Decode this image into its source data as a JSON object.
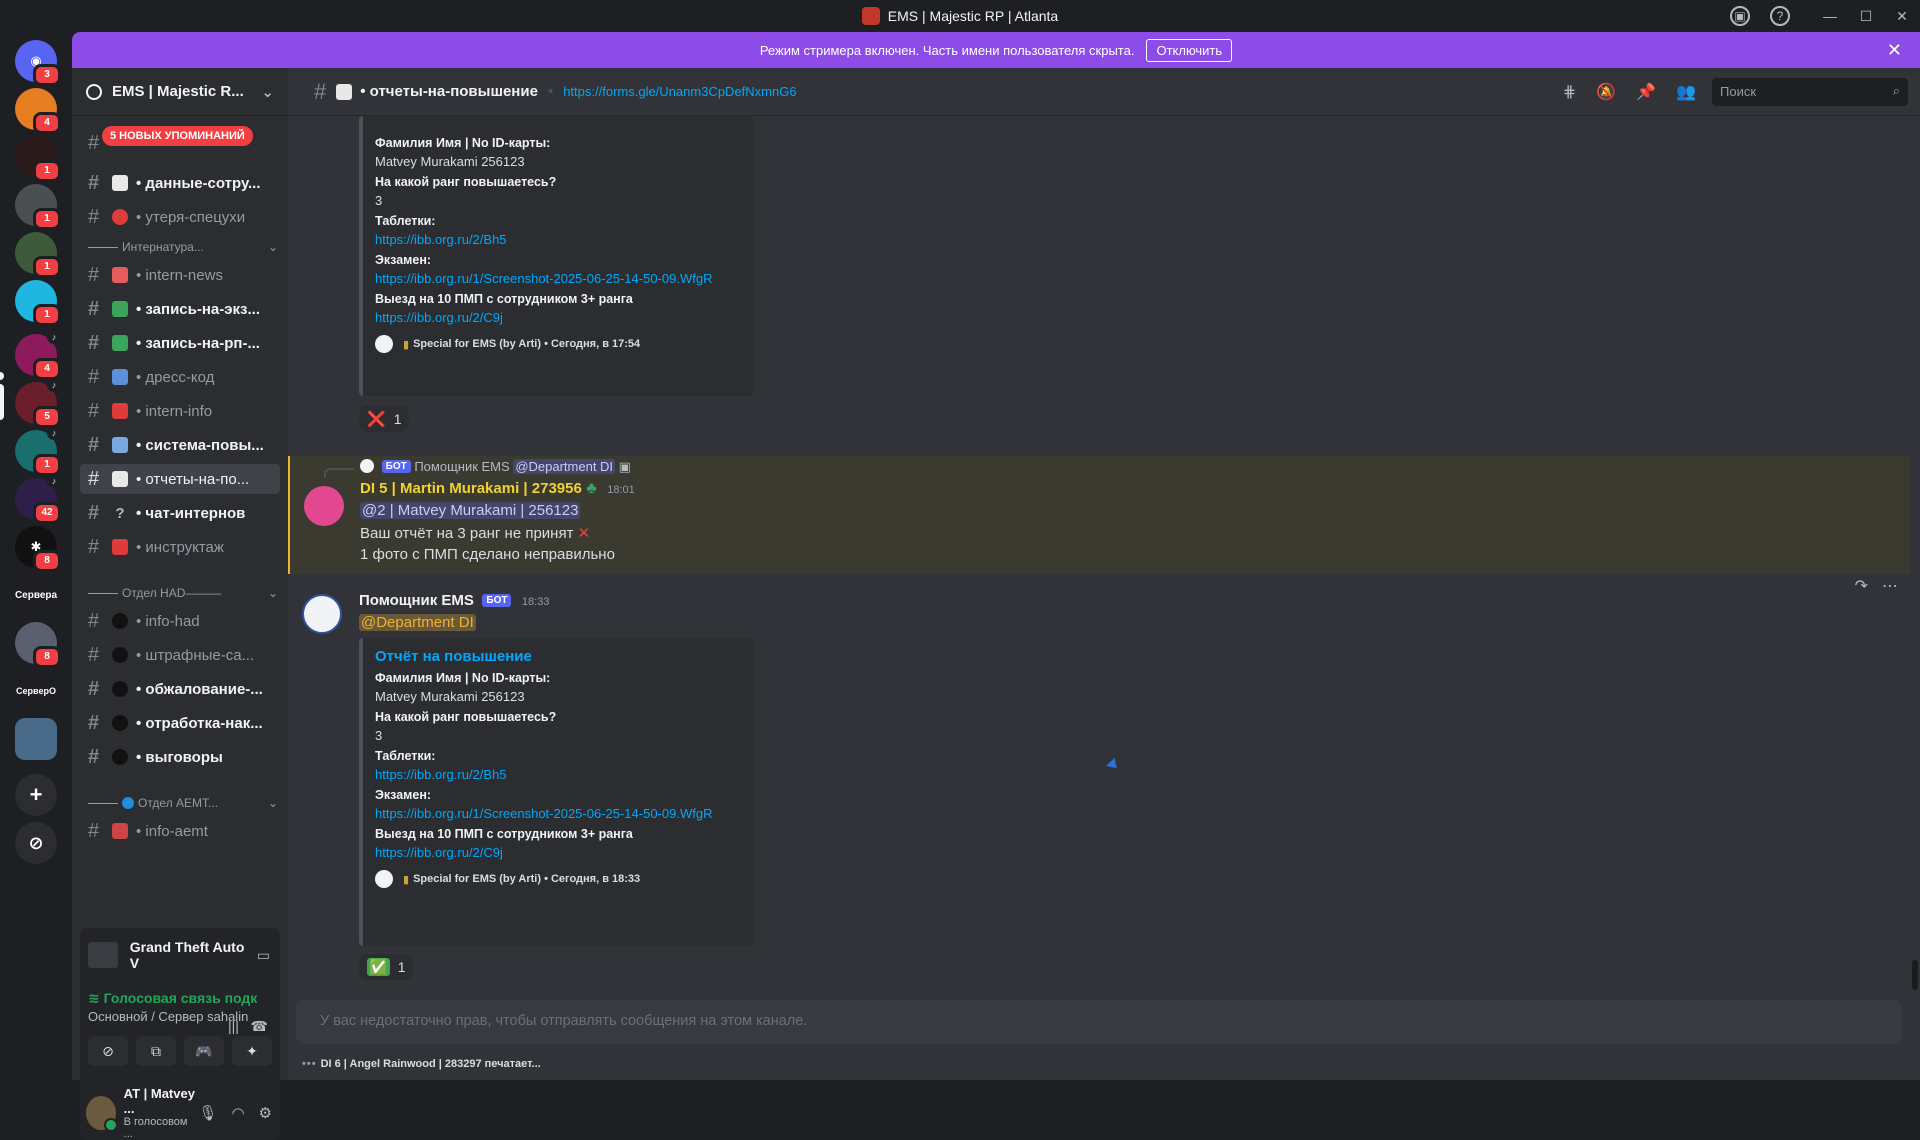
{
  "window": {
    "title": "EMS | Majestic RP | Atlanta"
  },
  "streamer_banner": {
    "text": "Режим стримера включен. Часть имени пользователя скрыта.",
    "button": "Отключить"
  },
  "guilds": [
    {
      "badge": "3"
    },
    {
      "badge": "4"
    },
    {
      "badge": "1"
    },
    {
      "badge": "1"
    },
    {
      "badge": "1"
    },
    {
      "badge": "1"
    },
    {
      "badge": "4"
    },
    {
      "badge": "5"
    },
    {
      "badge": "1"
    },
    {
      "badge": "42"
    },
    {
      "badge": "8"
    },
    {
      "label": "Сервера"
    },
    {
      "badge": "8"
    },
    {
      "label": "СерверО"
    },
    {
      "badge": ""
    }
  ],
  "server": {
    "name": "EMS | Majestic R...",
    "mentions_pill": "5 НОВЫХ УПОМИНАНИЙ",
    "channels_top": [
      {
        "name": "• данные-сотру...",
        "unread": true
      },
      {
        "name": "• утеря-спецухи",
        "unread": false
      }
    ],
    "category_intern": "Интернатура...",
    "channels_intern": [
      {
        "name": "• intern-news",
        "unread": false
      },
      {
        "name": "• запись-на-экз...",
        "unread": true
      },
      {
        "name": "• запись-на-рп-...",
        "unread": true
      },
      {
        "name": "• дресс-код",
        "unread": false
      },
      {
        "name": "• intern-info",
        "unread": false
      },
      {
        "name": "• система-повы...",
        "unread": true
      },
      {
        "name": "• отчеты-на-по...",
        "unread": false,
        "active": true
      },
      {
        "name": "• чат-интернов",
        "unread": true
      },
      {
        "name": "• инструктаж",
        "unread": false
      }
    ],
    "category_had": "Отдел HAD———",
    "channels_had": [
      {
        "name": "• info-had",
        "unread": false
      },
      {
        "name": "• штрафные-са...",
        "unread": false
      },
      {
        "name": "• обжалование-...",
        "unread": true
      },
      {
        "name": "• отработка-нак...",
        "unread": true
      },
      {
        "name": "• выговоры",
        "unread": true
      }
    ],
    "category_aemt": "Отдел AEMT...",
    "channels_aemt": [
      {
        "name": "• info-aemt",
        "unread": false
      }
    ]
  },
  "activity": {
    "game": "Grand Theft Auto V"
  },
  "voice": {
    "status": "Голосовая связь подк",
    "location": "Основной / Сервер sahalin"
  },
  "user": {
    "name": "AT | Matvey ...",
    "status": "В голосовом ..."
  },
  "channel_header": {
    "name": "• отчеты-на-повышение",
    "topic": "https://forms.gle/Unanm3CpDefNxmnG6",
    "search_placeholder": "Поиск"
  },
  "embed_top": {
    "fields": [
      {
        "name": "Фамилия Имя | No ID-карты:",
        "value": "Matvey Murakami 256123",
        "link": false
      },
      {
        "name": "На какой ранг повышаетесь?",
        "value": "3",
        "link": false
      },
      {
        "name": "Таблетки:",
        "value": "https://ibb.org.ru/2/Bh5",
        "link": true
      },
      {
        "name": "Экзамен:",
        "value": "https://ibb.org.ru/1/Screenshot-2025-06-25-14-50-09.WfgR",
        "link": true
      },
      {
        "name": "Выезд на 10 ПМП с сотрудником 3+ ранга",
        "value": "https://ibb.org.ru/2/C9j",
        "link": true
      }
    ],
    "footer": "Special for EMS (by Arti) • Сегодня, в 17:54",
    "reaction": {
      "emoji": "❌",
      "count": "1"
    }
  },
  "reply_message": {
    "reply_author": "Помощник EMS",
    "reply_mention": "@Department DI",
    "bot_tag": "БОТ",
    "author": "DI 5 | Martin Murakami | 273956",
    "time": "18:01",
    "mention": "@2 | Matvey Murakami | 256123",
    "line1": "Ваш отчёт на 3 ранг не принят",
    "line2": "1 фото с ПМП сделано неправильно"
  },
  "bot_message": {
    "author": "Помощник EMS",
    "bot_tag": "БОТ",
    "time": "18:33",
    "mention": "@Department DI",
    "embed": {
      "title": "Отчёт на повышение",
      "fields": [
        {
          "name": "Фамилия Имя | No ID-карты:",
          "value": "Matvey Murakami 256123",
          "link": false
        },
        {
          "name": "На какой ранг повышаетесь?",
          "value": "3",
          "link": false
        },
        {
          "name": "Таблетки:",
          "value": "https://ibb.org.ru/2/Bh5",
          "link": true
        },
        {
          "name": "Экзамен:",
          "value": "https://ibb.org.ru/1/Screenshot-2025-06-25-14-50-09.WfgR",
          "link": true
        },
        {
          "name": "Выезд на 10 ПМП с сотрудником 3+ ранга",
          "value": "https://ibb.org.ru/2/C9j",
          "link": true
        }
      ],
      "footer": "Special for EMS (by Arti) • Сегодня, в 18:33"
    },
    "reaction": {
      "emoji": "✅",
      "count": "1"
    }
  },
  "composer": {
    "placeholder": "У вас недостаточно прав, чтобы отправлять сообщения на этом канале."
  },
  "typing": {
    "text": "DI 6 | Angel Rainwood | 283297 печатает..."
  },
  "colors": {
    "accent": "#5865f2",
    "banner": "#8d4be8",
    "mention_badge": "#f23f43",
    "online": "#23a55a"
  }
}
